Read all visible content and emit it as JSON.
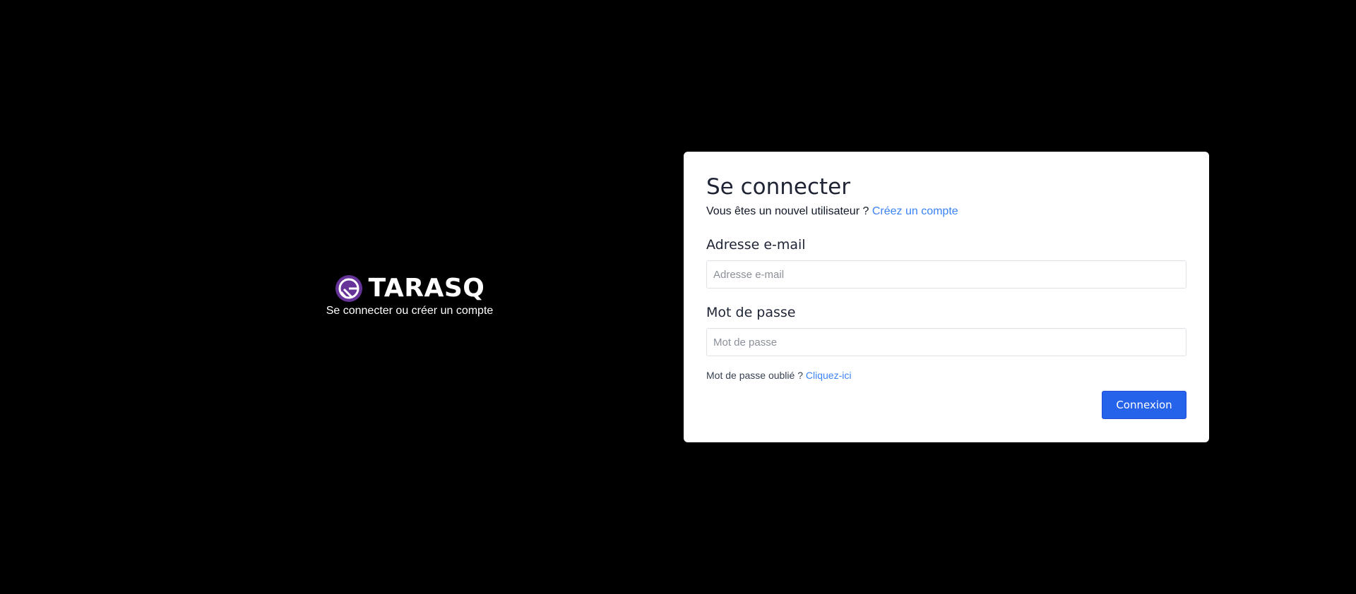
{
  "brand": {
    "name": "TARASQ",
    "tagline": "Se connecter ou créer un compte",
    "logo_icon": "gatsby-logo-icon",
    "logo_color": "#663399"
  },
  "login": {
    "title": "Se connecter",
    "new_user_text": "Vous êtes un nouvel utilisateur ?",
    "create_account_link": "Créez un compte",
    "email": {
      "label": "Adresse e-mail",
      "placeholder": "Adresse e-mail",
      "value": ""
    },
    "password": {
      "label": "Mot de passe",
      "placeholder": "Mot de passe",
      "value": ""
    },
    "forgot_text": "Mot de passe oublié ?",
    "forgot_link": "Cliquez-ici",
    "submit_label": "Connexion"
  },
  "colors": {
    "background": "#000000",
    "card": "#ffffff",
    "primary": "#2563eb",
    "link": "#3b82f6"
  }
}
